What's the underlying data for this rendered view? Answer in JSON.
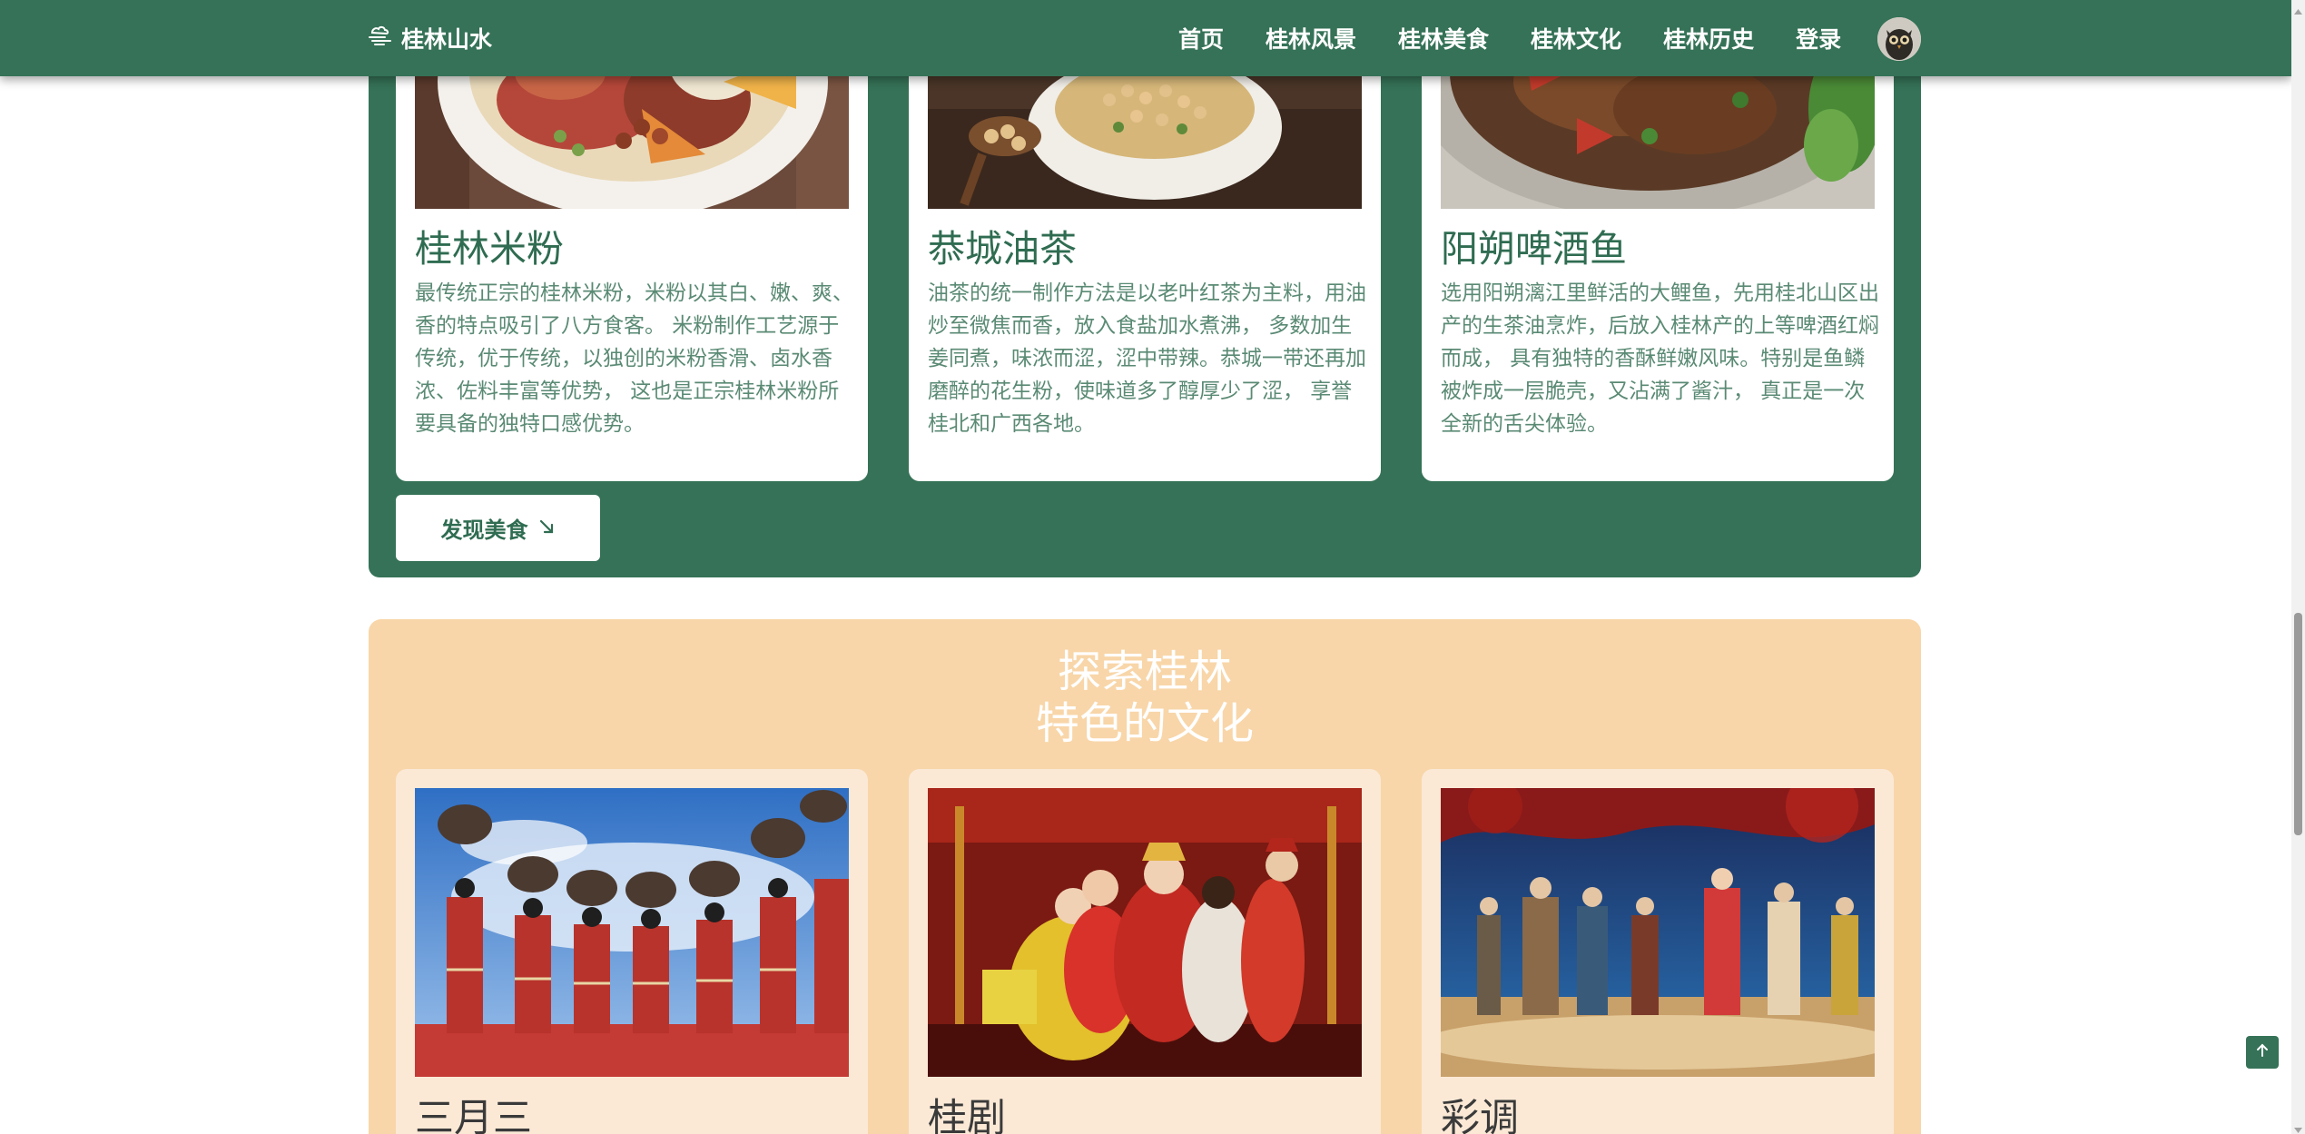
{
  "nav": {
    "brand": "桂林山水",
    "brand_icon": "mountain-cloud-icon",
    "links": [
      "首页",
      "桂林风景",
      "桂林美食",
      "桂林文化",
      "桂林历史",
      "登录"
    ],
    "avatar_icon": "owl-avatar"
  },
  "food": {
    "cards": [
      {
        "title": "桂林米粉",
        "desc": "最传统正宗的桂林米粉，米粉以其白、嫩、爽、香的特点吸引了八方食客。 米粉制作工艺源于传统，优于传统，以独创的米粉香滑、卤水香浓、佐料丰富等优势， 这也是正宗桂林米粉所要具备的独特口感优势。"
      },
      {
        "title": "恭城油茶",
        "desc": "油茶的统一制作方法是以老叶红茶为主料，用油炒至微焦而香，放入食盐加水煮沸， 多数加生姜同煮，味浓而涩，涩中带辣。恭城一带还再加磨醉的花生粉，使味道多了醇厚少了涩， 享誉桂北和广西各地。"
      },
      {
        "title": "阳朔啤酒鱼",
        "desc": "选用阳朔漓江里鲜活的大鲤鱼，先用桂北山区出产的生茶油烹炸，后放入桂林产的上等啤酒红焖而成， 具有独特的香酥鲜嫩风味。特别是鱼鳞被炸成一层脆壳，又沾满了酱汁， 真正是一次全新的舌尖体验。"
      }
    ],
    "discover_label": "发现美食",
    "discover_icon": "arrow-down-right-icon"
  },
  "culture": {
    "title_line1": "探索桂林",
    "title_line2": "特色的文化",
    "cards": [
      {
        "title": "三月三"
      },
      {
        "title": "桂剧"
      },
      {
        "title": "彩调"
      }
    ]
  },
  "colors": {
    "primary": "#357257",
    "culture_bg": "#f8d6a9",
    "culture_card": "#fbe9d6"
  },
  "back_to_top_icon": "arrow-up-icon"
}
